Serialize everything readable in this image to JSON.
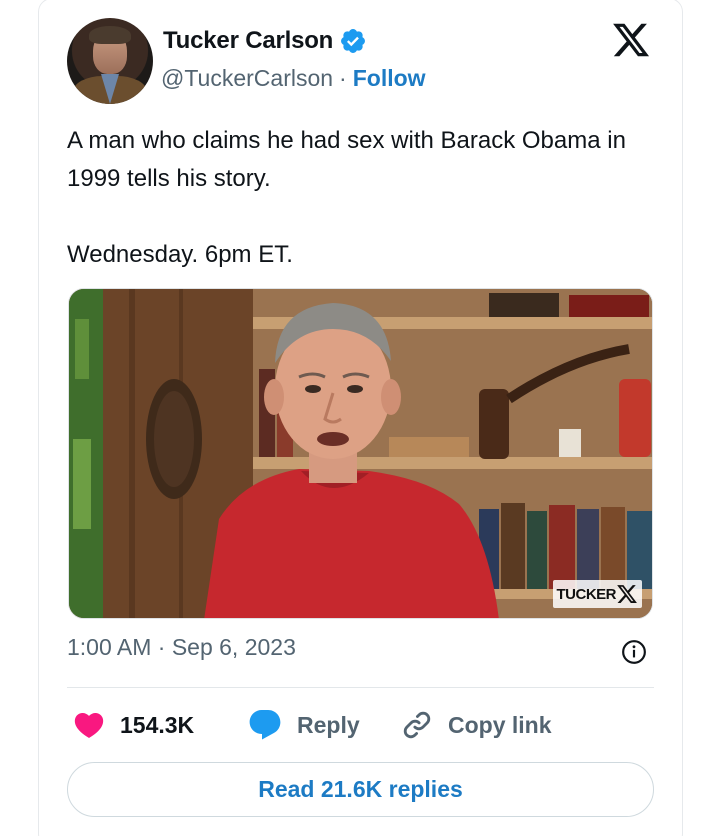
{
  "author": {
    "name": "Tucker Carlson",
    "handle": "@TuckerCarlson",
    "separator": "·",
    "follow_label": "Follow",
    "verified": true
  },
  "platform_icon": "x-logo-icon",
  "tweet": {
    "lines": [
      "A man who claims he had sex with Barack Obama in 1999 tells his story.",
      "Wednesday. 6pm ET."
    ],
    "timestamp": "1:00 AM · Sep 6, 2023"
  },
  "media": {
    "type": "video-still",
    "watermark": "TUCKER"
  },
  "actions": {
    "likes": "154.3K",
    "reply_label": "Reply",
    "copy_link_label": "Copy link"
  },
  "read_replies_label": "Read 21.6K replies",
  "colors": {
    "accent": "#1d7bc4",
    "like": "#f91880",
    "text": "#0f1419",
    "muted": "#536471"
  }
}
